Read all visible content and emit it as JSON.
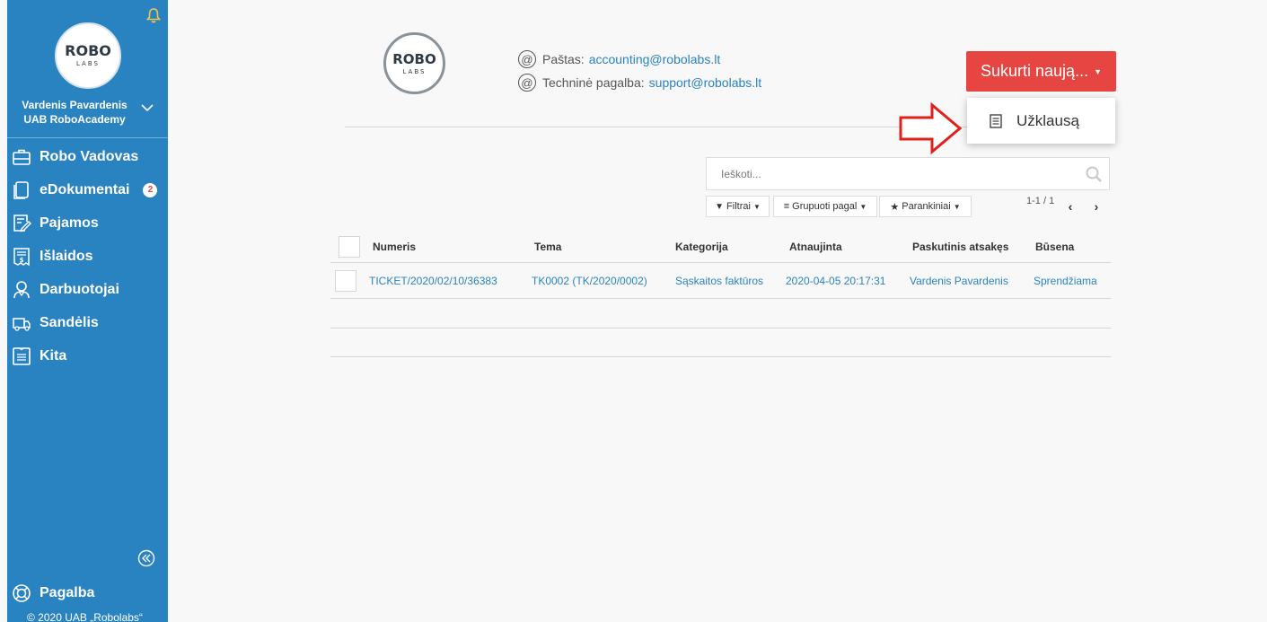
{
  "sidebar": {
    "user_name": "Vardenis Pavardenis",
    "company": "UAB RoboAcademy",
    "logo_text": "ROBO",
    "logo_sub": "LABS",
    "items": [
      {
        "label": "Robo Vadovas",
        "icon": "briefcase-icon"
      },
      {
        "label": "eDokumentai",
        "icon": "documents-icon",
        "badge": "2"
      },
      {
        "label": "Pajamos",
        "icon": "invoice-edit-icon"
      },
      {
        "label": "Išlaidos",
        "icon": "receipt-icon"
      },
      {
        "label": "Darbuotojai",
        "icon": "employee-icon"
      },
      {
        "label": "Sandėlis",
        "icon": "truck-icon"
      },
      {
        "label": "Kita",
        "icon": "list-icon"
      }
    ],
    "help_label": "Pagalba",
    "copyright": "© 2020 UAB „Robolabs“"
  },
  "header": {
    "logo_text": "ROBO",
    "logo_sub": "LABS",
    "email_label": "Paštas:",
    "email_value": "accounting@robolabs.lt",
    "support_label": "Techninė pagalba:",
    "support_value": "support@robolabs.lt",
    "create_button": "Sukurti naują...",
    "dropdown_item": "Užklausą"
  },
  "toolbar": {
    "search_placeholder": "Ieškoti...",
    "filters": "Filtrai",
    "group_by": "Grupuoti pagal",
    "favorites": "Parankiniai",
    "pager": "1-1 / 1"
  },
  "table": {
    "headers": [
      "Numeris",
      "Tema",
      "Kategorija",
      "Atnaujinta",
      "Paskutinis atsakęs",
      "Būsena"
    ],
    "rows": [
      [
        "TICKET/2020/02/10/36383",
        "TK0002 (TK/2020/0002)",
        "Sąskaitos faktūros",
        "2020-04-05 20:17:31",
        "Vardenis Pavardenis",
        "Sprendžiama"
      ]
    ]
  },
  "colors": {
    "sidebar": "#2a83c1",
    "accent_red": "#e64541",
    "link": "#2a83c1"
  }
}
